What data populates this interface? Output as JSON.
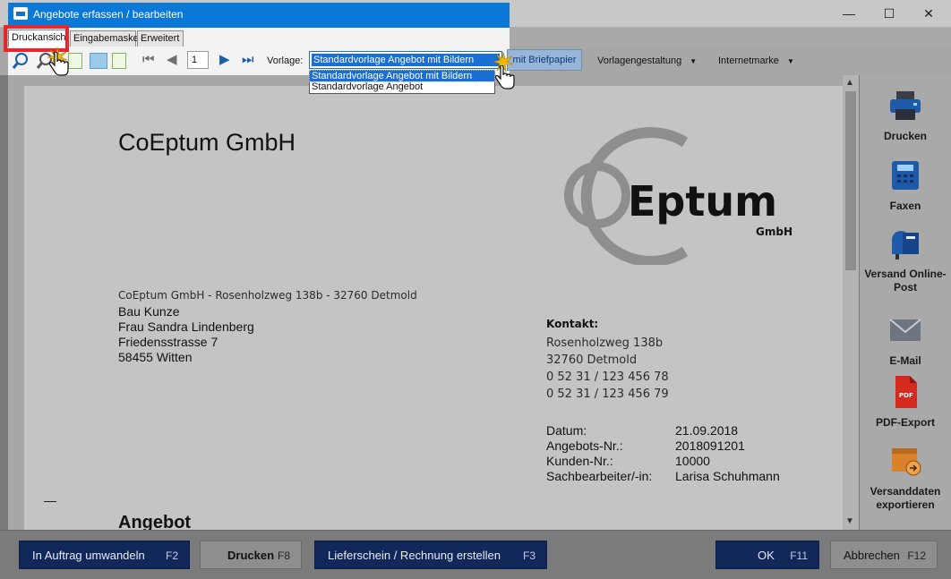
{
  "window": {
    "title": "Angebote erfassen / bearbeiten",
    "minimize": "—",
    "maximize": "☐",
    "close": "✕"
  },
  "tabs": [
    {
      "label": "Druckansicht",
      "active": true
    },
    {
      "label": "Eingabemaske",
      "active": false
    },
    {
      "label": "Erweitert",
      "active": false
    }
  ],
  "toolbar": {
    "page_number": "1",
    "vorlage_label": "Vorlage:",
    "vorlage_selected": "Standardvorlage Angebot mit Bildern",
    "vorlage_options": [
      "Standardvorlage Angebot mit Bildern",
      "Standardvorlage Angebot"
    ],
    "briefpapier_button": "mit Briefpapier",
    "vorlagengestaltung_menu": "Vorlagengestaltung",
    "internetmarke_menu": "Internetmarke"
  },
  "document": {
    "company_name": "CoEptum GmbH",
    "logo_text": "Eptum",
    "logo_subtext": "GmbH",
    "sender_line": "CoEptum GmbH - Rosenholzweg 138b - 32760 Detmold",
    "recipient": [
      "Bau Kunze",
      "Frau Sandra Lindenberg",
      "Friedensstrasse 7",
      "58455 Witten"
    ],
    "kontakt_heading": "Kontakt:",
    "kontakt_lines": [
      "Rosenholzweg 138b",
      "32760 Detmold",
      "0 52 31 / 123 456 78",
      "0 52 31 / 123 456 79"
    ],
    "meta": [
      {
        "label": "Datum:",
        "value": "21.09.2018"
      },
      {
        "label": "Angebots-Nr.:",
        "value": "2018091201"
      },
      {
        "label": "Kunden-Nr.:",
        "value": "10000"
      },
      {
        "label": "Sachbearbeiter/-in:",
        "value": "Larisa Schuhmann"
      }
    ],
    "fold_mark": "—",
    "heading": "Angebot"
  },
  "sidebar": [
    {
      "label": "Drucken",
      "icon": "printer-icon"
    },
    {
      "label": "Faxen",
      "icon": "fax-icon"
    },
    {
      "label": "Versand Online-Post",
      "icon": "mailbox-icon"
    },
    {
      "label": "E-Mail",
      "icon": "envelope-icon"
    },
    {
      "label": "PDF-Export",
      "icon": "pdf-icon"
    },
    {
      "label": "Versanddaten exportieren",
      "icon": "package-export-icon"
    }
  ],
  "footer": {
    "auftrag": {
      "label": "In Auftrag umwandeln",
      "key": "F2"
    },
    "drucken": {
      "label": "Drucken",
      "key": "F8"
    },
    "lieferschein": {
      "label": "Lieferschein / Rechnung erstellen",
      "key": "F3"
    },
    "ok": {
      "label": "OK",
      "key": "F11"
    },
    "abbrechen": {
      "label": "Abbrechen",
      "key": "F12"
    }
  },
  "colors": {
    "title_active": "#0a78d7",
    "highlight_marker": "#e8262b",
    "footer_button": "#12285a",
    "sidebar_icon_blue": "#1f5aa8",
    "pdf_red": "#d42a1f",
    "package_orange": "#d9822b"
  }
}
